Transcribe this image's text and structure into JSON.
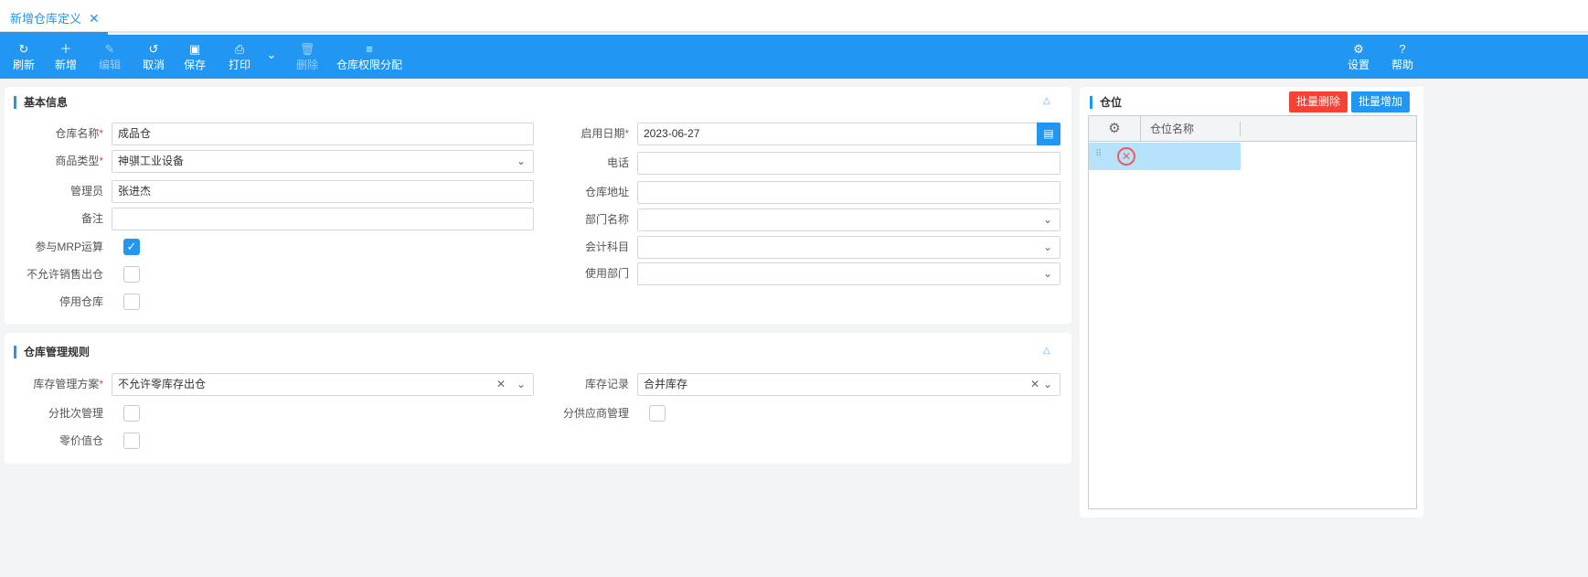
{
  "tab": {
    "title": "新增仓库定义",
    "close": "✕"
  },
  "toolbar": {
    "refresh": "刷新",
    "add": "新增",
    "edit": "编辑",
    "cancel": "取消",
    "save": "保存",
    "print": "打印",
    "delete": "删除",
    "perm": "仓库权限分配",
    "settings": "设置",
    "help": "帮助"
  },
  "basic": {
    "title": "基本信息",
    "name_label": "仓库名称",
    "name_value": "成品仓",
    "type_label": "商品类型",
    "type_value": "神骐工业设备",
    "admin_label": "管理员",
    "admin_value": "张进杰",
    "note_label": "备注",
    "note_value": "",
    "mrp_label": "参与MRP运算",
    "mrp_checked": true,
    "nosale_label": "不允许销售出仓",
    "nosale_checked": false,
    "disable_label": "停用仓库",
    "disable_checked": false,
    "date_label": "启用日期",
    "date_value": "2023-06-27",
    "phone_label": "电话",
    "addr_label": "仓库地址",
    "dept_label": "部门名称",
    "acct_label": "会计科目",
    "usedept_label": "使用部门"
  },
  "rules": {
    "title": "仓库管理规则",
    "plan_label": "库存管理方案",
    "plan_value": "不允许零库存出仓",
    "record_label": "库存记录",
    "record_value": "合并库存",
    "batch_label": "分批次管理",
    "zero_label": "零价值仓",
    "supplier_label": "分供应商管理"
  },
  "location": {
    "title": "仓位",
    "batch_delete": "批量删除",
    "batch_add": "批量增加",
    "col_name": "仓位名称"
  },
  "colors": {
    "primary": "#2196f3",
    "danger": "#f44336",
    "selected_row": "#b6e2fb"
  }
}
